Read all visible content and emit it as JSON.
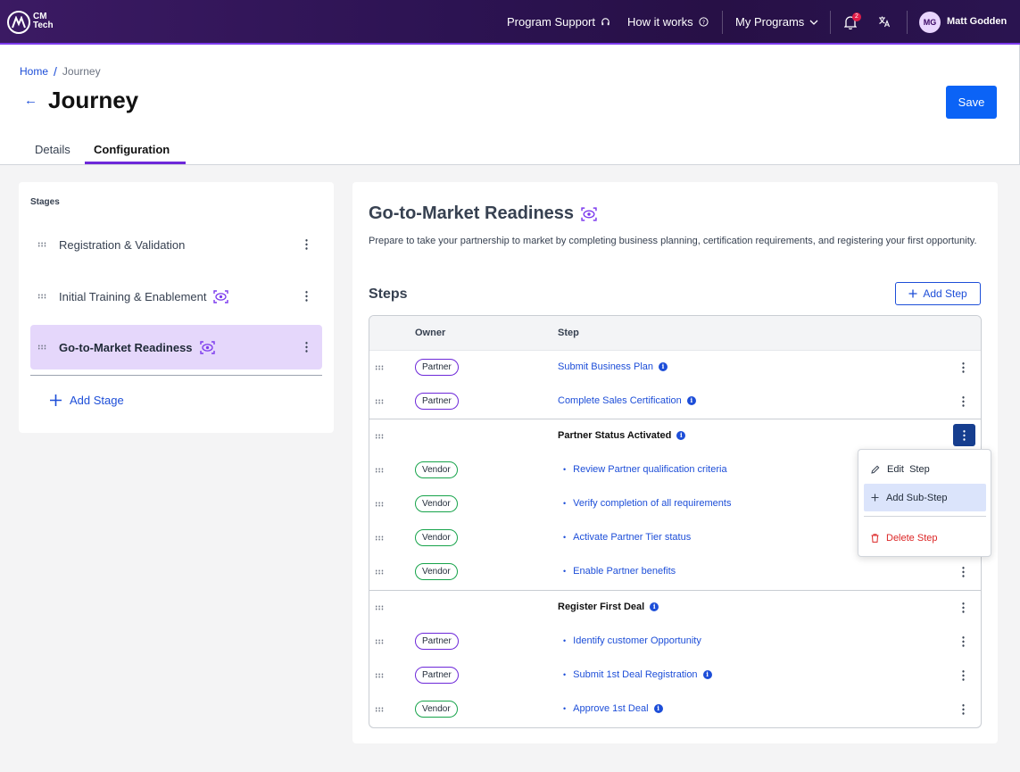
{
  "nav": {
    "brand_line1": "CM",
    "brand_line2": "Tech",
    "program_support": "Program Support",
    "how_it_works": "How it works",
    "my_programs": "My Programs",
    "notification_count": "2",
    "user_initials": "MG",
    "user_name": "Matt Godden"
  },
  "breadcrumb": {
    "home": "Home",
    "sep": "/",
    "current": "Journey"
  },
  "page": {
    "title": "Journey",
    "save_label": "Save"
  },
  "tabs": {
    "details": "Details",
    "configuration": "Configuration",
    "active": "Configuration"
  },
  "stages": {
    "heading": "Stages",
    "items": [
      {
        "label": "Registration & Validation",
        "has_icon": false
      },
      {
        "label": "Initial Training & Enablement",
        "has_icon": true
      },
      {
        "label": "Go-to-Market Readiness",
        "has_icon": true,
        "active": true
      }
    ],
    "add_label": "Add Stage"
  },
  "main": {
    "title": "Go-to-Market Readiness",
    "description": "Prepare to take your partnership to market by completing business planning, certification requirements, and registering your first opportunity.",
    "steps_heading": "Steps",
    "add_step_label": "Add Step",
    "col_owner": "Owner",
    "col_step": "Step",
    "rows": [
      {
        "owner": "Partner",
        "step": "Submit Business Plan",
        "info": true
      },
      {
        "owner": "Partner",
        "step": "Complete Sales Certification",
        "info": true
      },
      {
        "owner": "",
        "step": "Partner Status Activated",
        "info": true,
        "group": true
      },
      {
        "owner": "Vendor",
        "step": "Review Partner qualification criteria",
        "sub": true
      },
      {
        "owner": "Vendor",
        "step": "Verify completion of all requirements",
        "sub": true
      },
      {
        "owner": "Vendor",
        "step": "Activate Partner Tier status",
        "sub": true
      },
      {
        "owner": "Vendor",
        "step": "Enable Partner benefits",
        "sub": true
      },
      {
        "owner": "",
        "step": "Register First Deal",
        "info": true,
        "group": true
      },
      {
        "owner": "Partner",
        "step": "Identify customer Opportunity",
        "sub": true
      },
      {
        "owner": "Partner",
        "step": "Submit 1st Deal Registration",
        "sub": true,
        "info": true
      },
      {
        "owner": "Vendor",
        "step": "Approve 1st Deal",
        "sub": true,
        "info": true
      }
    ]
  },
  "menu": {
    "edit_step": "Edit  Step",
    "add_sub_step": "Add Sub-Step",
    "delete_step": "Delete Step"
  },
  "colors": {
    "accent_purple": "#6d28d9",
    "primary_blue": "#0b63f6",
    "link_blue": "#1d4ed8",
    "active_stage_bg": "#e5d7fb",
    "vendor_green": "#16a34a",
    "danger_red": "#dc2626"
  }
}
